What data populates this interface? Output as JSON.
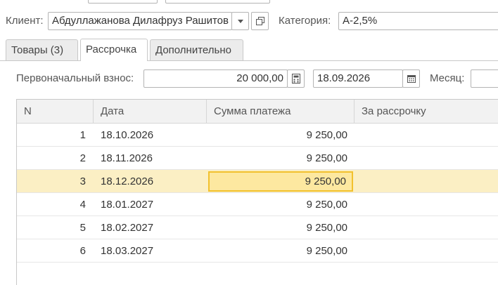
{
  "header": {
    "client_label": "Клиент:",
    "client_value": "Абдуллажанова Дилафруз Рашитов",
    "category_label": "Категория:",
    "category_value": "А-2,5%"
  },
  "tabs": [
    {
      "label": "Товары (3)",
      "active": false
    },
    {
      "label": "Рассрочка",
      "active": true
    },
    {
      "label": "Дополнительно",
      "active": false
    }
  ],
  "payment": {
    "down_payment_label": "Первоначальный взнос:",
    "down_payment_value": "20 000,00",
    "date_value": "18.09.2026",
    "month_label": "Месяц:"
  },
  "table": {
    "columns": [
      "N",
      "Дата",
      "Сумма платежа",
      "За рассрочку"
    ],
    "rows": [
      {
        "n": "1",
        "date": "18.10.2026",
        "amount": "9 250,00",
        "fee": ""
      },
      {
        "n": "2",
        "date": "18.11.2026",
        "amount": "9 250,00",
        "fee": ""
      },
      {
        "n": "3",
        "date": "18.12.2026",
        "amount": "9 250,00",
        "fee": ""
      },
      {
        "n": "4",
        "date": "18.01.2027",
        "amount": "9 250,00",
        "fee": ""
      },
      {
        "n": "5",
        "date": "18.02.2027",
        "amount": "9 250,00",
        "fee": ""
      },
      {
        "n": "6",
        "date": "18.03.2027",
        "amount": "9 250,00",
        "fee": ""
      }
    ],
    "selected_row_index": 2
  },
  "colors": {
    "selected_row": "#fbefc4",
    "current_cell_border": "#f2c12e",
    "current_cell_fill": "#fde8a0"
  },
  "icons": [
    "dropdown-arrow-icon",
    "open-form-icon",
    "calendar-icon"
  ]
}
